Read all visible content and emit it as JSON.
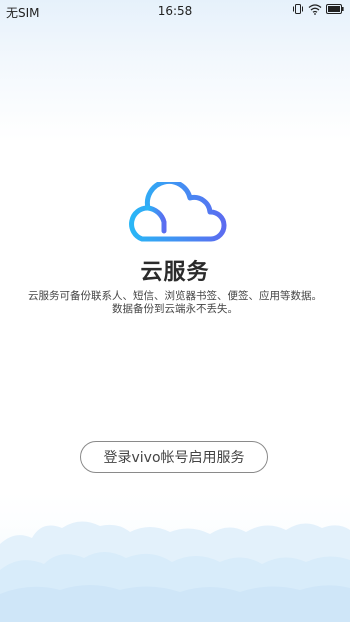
{
  "status_bar": {
    "carrier": "无SIM",
    "time": "16:58",
    "icons": [
      "vibrate-icon",
      "wifi-icon",
      "battery-icon"
    ]
  },
  "main": {
    "logo_icon": "cloud-icon",
    "title": "云服务",
    "description_line1": "云服务可备份联系人、短信、浏览器书签、便签、应用等数据。",
    "description_line2": "数据备份到云端永不丢失。"
  },
  "login_button": {
    "label": "登录vivo帐号启用服务"
  },
  "colors": {
    "cloud_gradient_start": "#29b6f6",
    "cloud_gradient_end": "#5b6cf0",
    "bottom_cloud": "#d8ecfa"
  }
}
